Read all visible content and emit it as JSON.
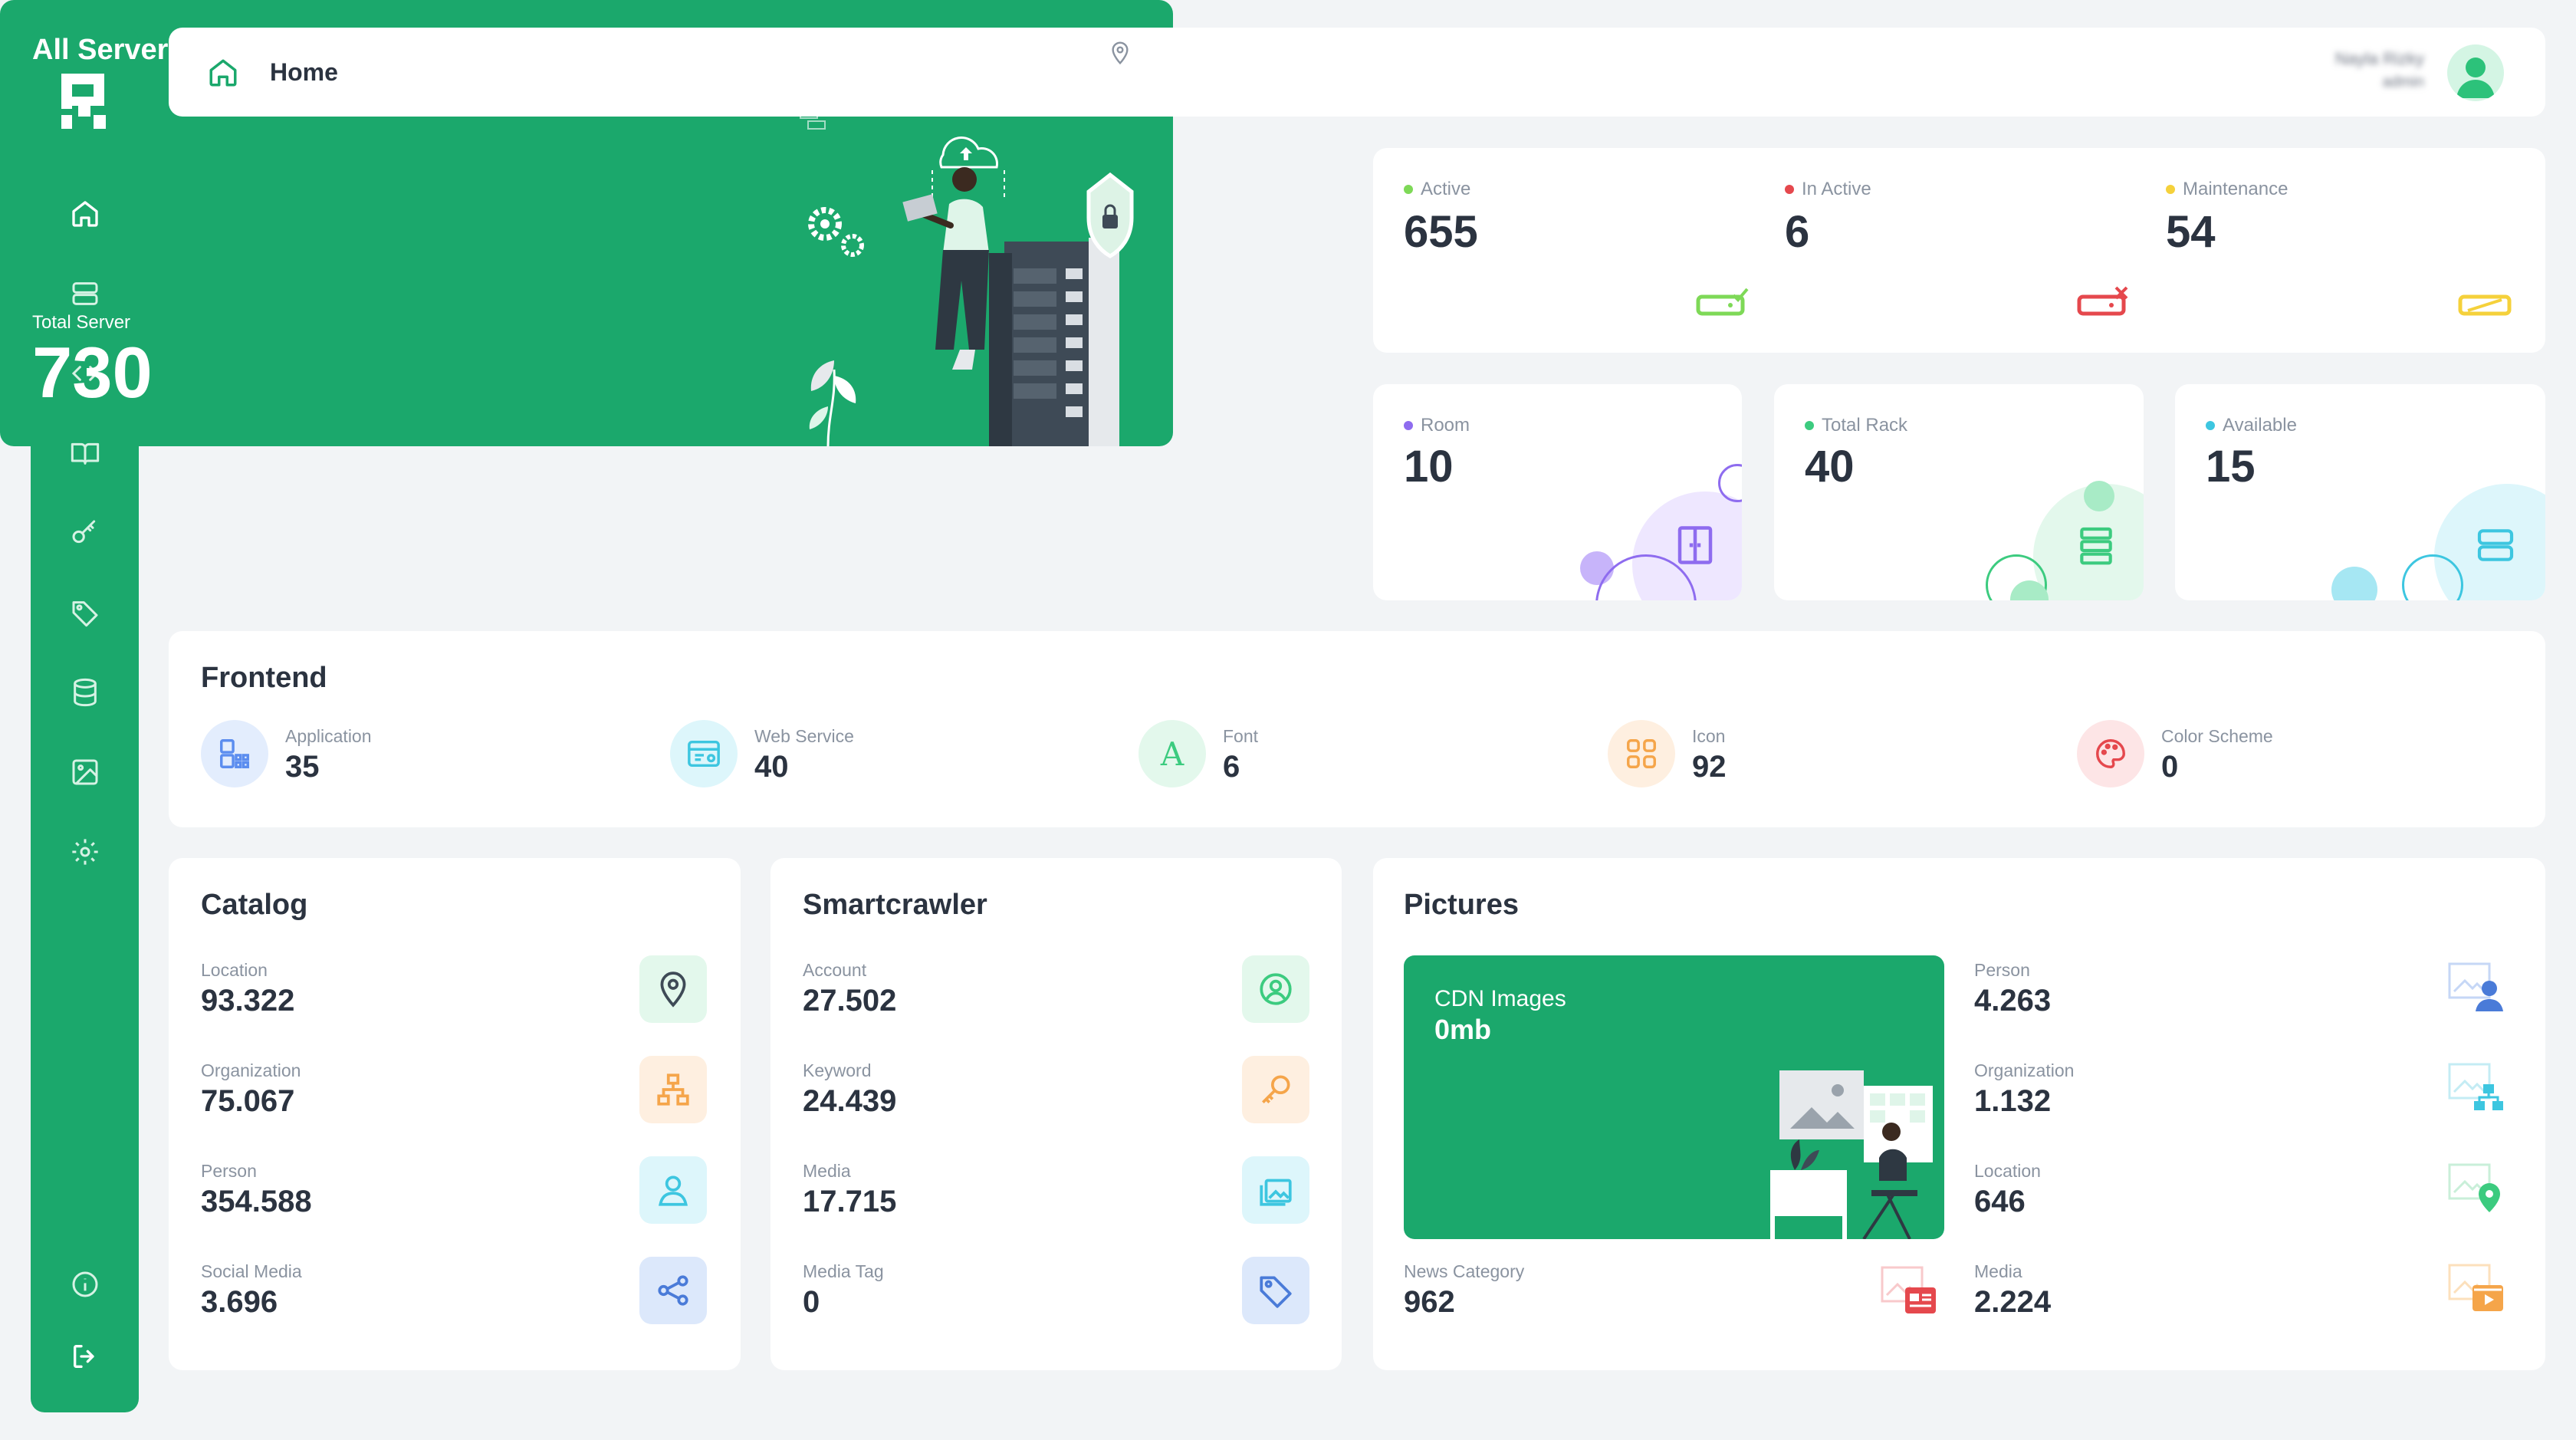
{
  "header": {
    "title": "Home",
    "user_name": "Nayla Rizky",
    "user_role": "admin"
  },
  "hero": {
    "title": "All Servers",
    "total_label": "Total Server",
    "total_value": "730"
  },
  "status": {
    "active": {
      "label": "Active",
      "value": "655",
      "color": "#7ED957"
    },
    "inactive": {
      "label": "In Active",
      "value": "6",
      "color": "#E5484D"
    },
    "maintenance": {
      "label": "Maintenance",
      "value": "54",
      "color": "#F5D13B"
    }
  },
  "mini": {
    "room": {
      "label": "Room",
      "value": "10",
      "color": "#8E6CEF"
    },
    "rack": {
      "label": "Total Rack",
      "value": "40",
      "color": "#3CCB7F"
    },
    "available": {
      "label": "Available",
      "value": "15",
      "color": "#3DC6E0"
    }
  },
  "frontend": {
    "title": "Frontend",
    "items": [
      {
        "label": "Application",
        "value": "35"
      },
      {
        "label": "Web Service",
        "value": "40"
      },
      {
        "label": "Font",
        "value": "6",
        "glyph": "A"
      },
      {
        "label": "Icon",
        "value": "92"
      },
      {
        "label": "Color Scheme",
        "value": "0"
      }
    ]
  },
  "catalog": {
    "title": "Catalog",
    "items": [
      {
        "label": "Location",
        "value": "93.322"
      },
      {
        "label": "Organization",
        "value": "75.067"
      },
      {
        "label": "Person",
        "value": "354.588"
      },
      {
        "label": "Social Media",
        "value": "3.696"
      }
    ]
  },
  "smartcrawler": {
    "title": "Smartcrawler",
    "items": [
      {
        "label": "Account",
        "value": "27.502"
      },
      {
        "label": "Keyword",
        "value": "24.439"
      },
      {
        "label": "Media",
        "value": "17.715"
      },
      {
        "label": "Media Tag",
        "value": "0"
      }
    ]
  },
  "pictures": {
    "title": "Pictures",
    "cdn": {
      "label": "CDN Images",
      "value": "0mb"
    },
    "news": {
      "label": "News Category",
      "value": "962"
    },
    "items": [
      {
        "label": "Person",
        "value": "4.263"
      },
      {
        "label": "Organization",
        "value": "1.132"
      },
      {
        "label": "Location",
        "value": "646"
      },
      {
        "label": "Media",
        "value": "2.224"
      }
    ]
  }
}
